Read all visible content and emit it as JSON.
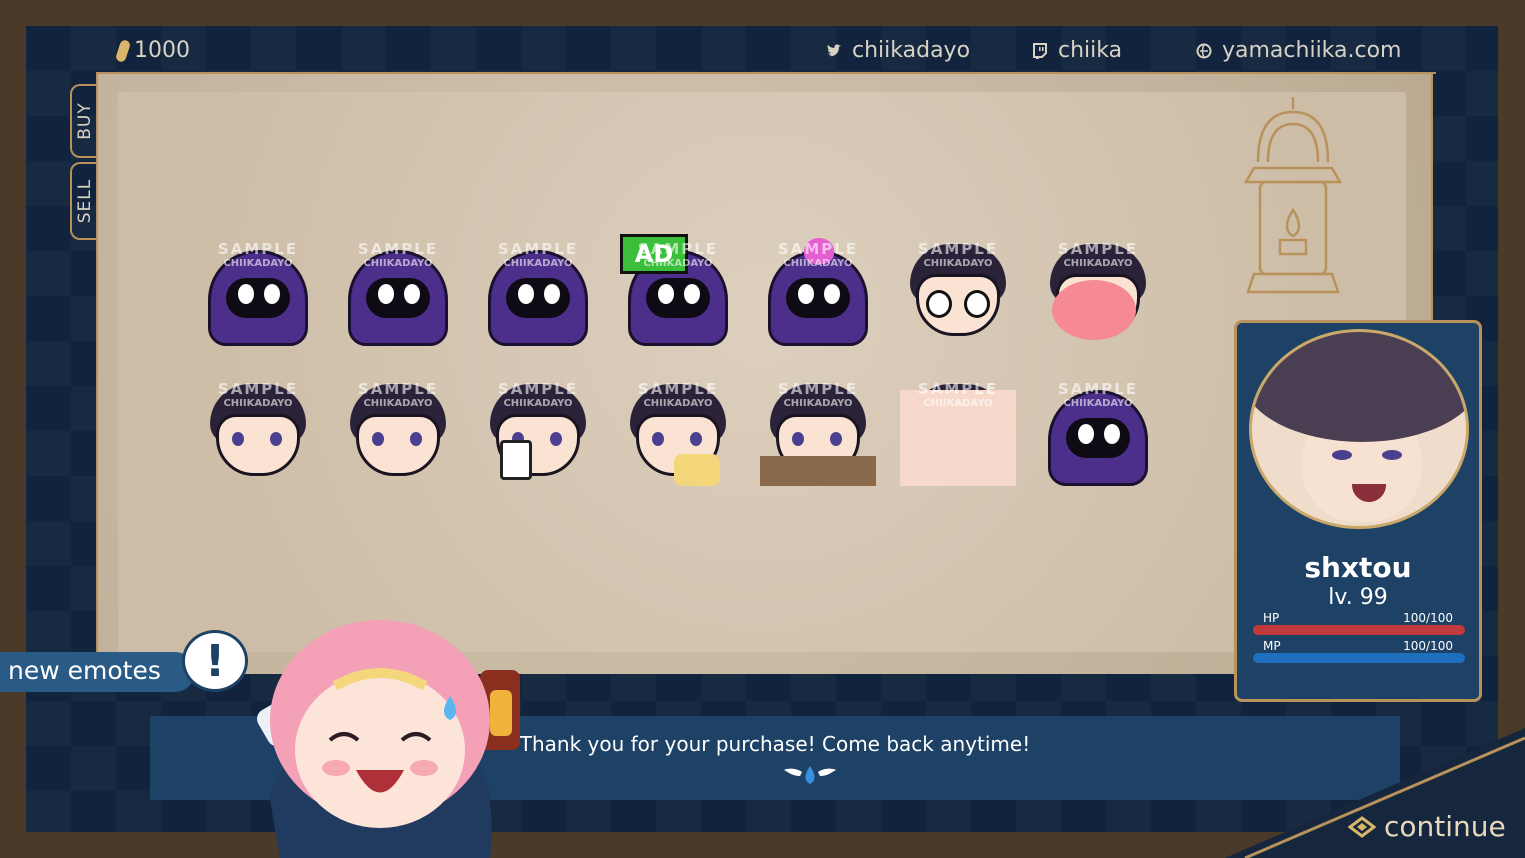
{
  "topbar": {
    "coins": "1000",
    "twitter": "chiikadayo",
    "twitch": "chiika",
    "website": "yamachiika.com"
  },
  "tabs": {
    "buy": "BUY",
    "sell": "SELL"
  },
  "emotes": [
    {
      "wm": "SAMPLE",
      "wm2": "CHIIKADAYO",
      "kind": "hood"
    },
    {
      "wm": "SAMPLE",
      "wm2": "CHIIKADAYO",
      "kind": "hood-big"
    },
    {
      "wm": "SAMPLE",
      "wm2": "CHIIKADAYO",
      "kind": "hood-cry"
    },
    {
      "wm": "SAMPLE",
      "wm2": "CHIIKADAYO",
      "kind": "hood-ad",
      "sign": "AD"
    },
    {
      "wm": "SAMPLE",
      "wm2": "CHIIKADAYO",
      "kind": "hood-heart"
    },
    {
      "wm": "SAMPLE",
      "wm2": "CHIIKADAYO",
      "kind": "boy-eyes"
    },
    {
      "wm": "SAMPLE",
      "wm2": "CHIIKADAYO",
      "kind": "boy-shout"
    },
    {
      "wm": "SAMPLE",
      "wm2": "CHIIKADAYO",
      "kind": "boy-sad"
    },
    {
      "wm": "SAMPLE",
      "wm2": "CHIIKADAYO",
      "kind": "boy-smile"
    },
    {
      "wm": "SAMPLE",
      "wm2": "CHIIKADAYO",
      "kind": "boy-cup"
    },
    {
      "wm": "SAMPLE",
      "wm2": "CHIIKADAYO",
      "kind": "boy-popcorn"
    },
    {
      "wm": "SAMPLE",
      "wm2": "CHIIKADAYO",
      "kind": "boy-cat"
    },
    {
      "wm": "SAMPLE",
      "wm2": "CHIIKADAYO",
      "kind": "boy-close"
    },
    {
      "wm": "SAMPLE",
      "wm2": "CHIIKADAYO",
      "kind": "hood-eat"
    }
  ],
  "profile": {
    "name": "shxtou",
    "level": "lv. 99",
    "hp_label": "HP",
    "hp_value": "100/100",
    "hp_fraction": 1.0,
    "mp_label": "MP",
    "mp_value": "100/100",
    "mp_fraction": 1.0,
    "hp_color": "#c0393b",
    "mp_color": "#1f6fbf"
  },
  "new_emotes_label": "new emotes",
  "bang": "!",
  "dialog": {
    "text": "Thank you for your purchase! Come back anytime!"
  },
  "continue_label": "continue",
  "colors": {
    "frame": "#12243d",
    "gold": "#b8925a",
    "panel": "#1e4166"
  }
}
